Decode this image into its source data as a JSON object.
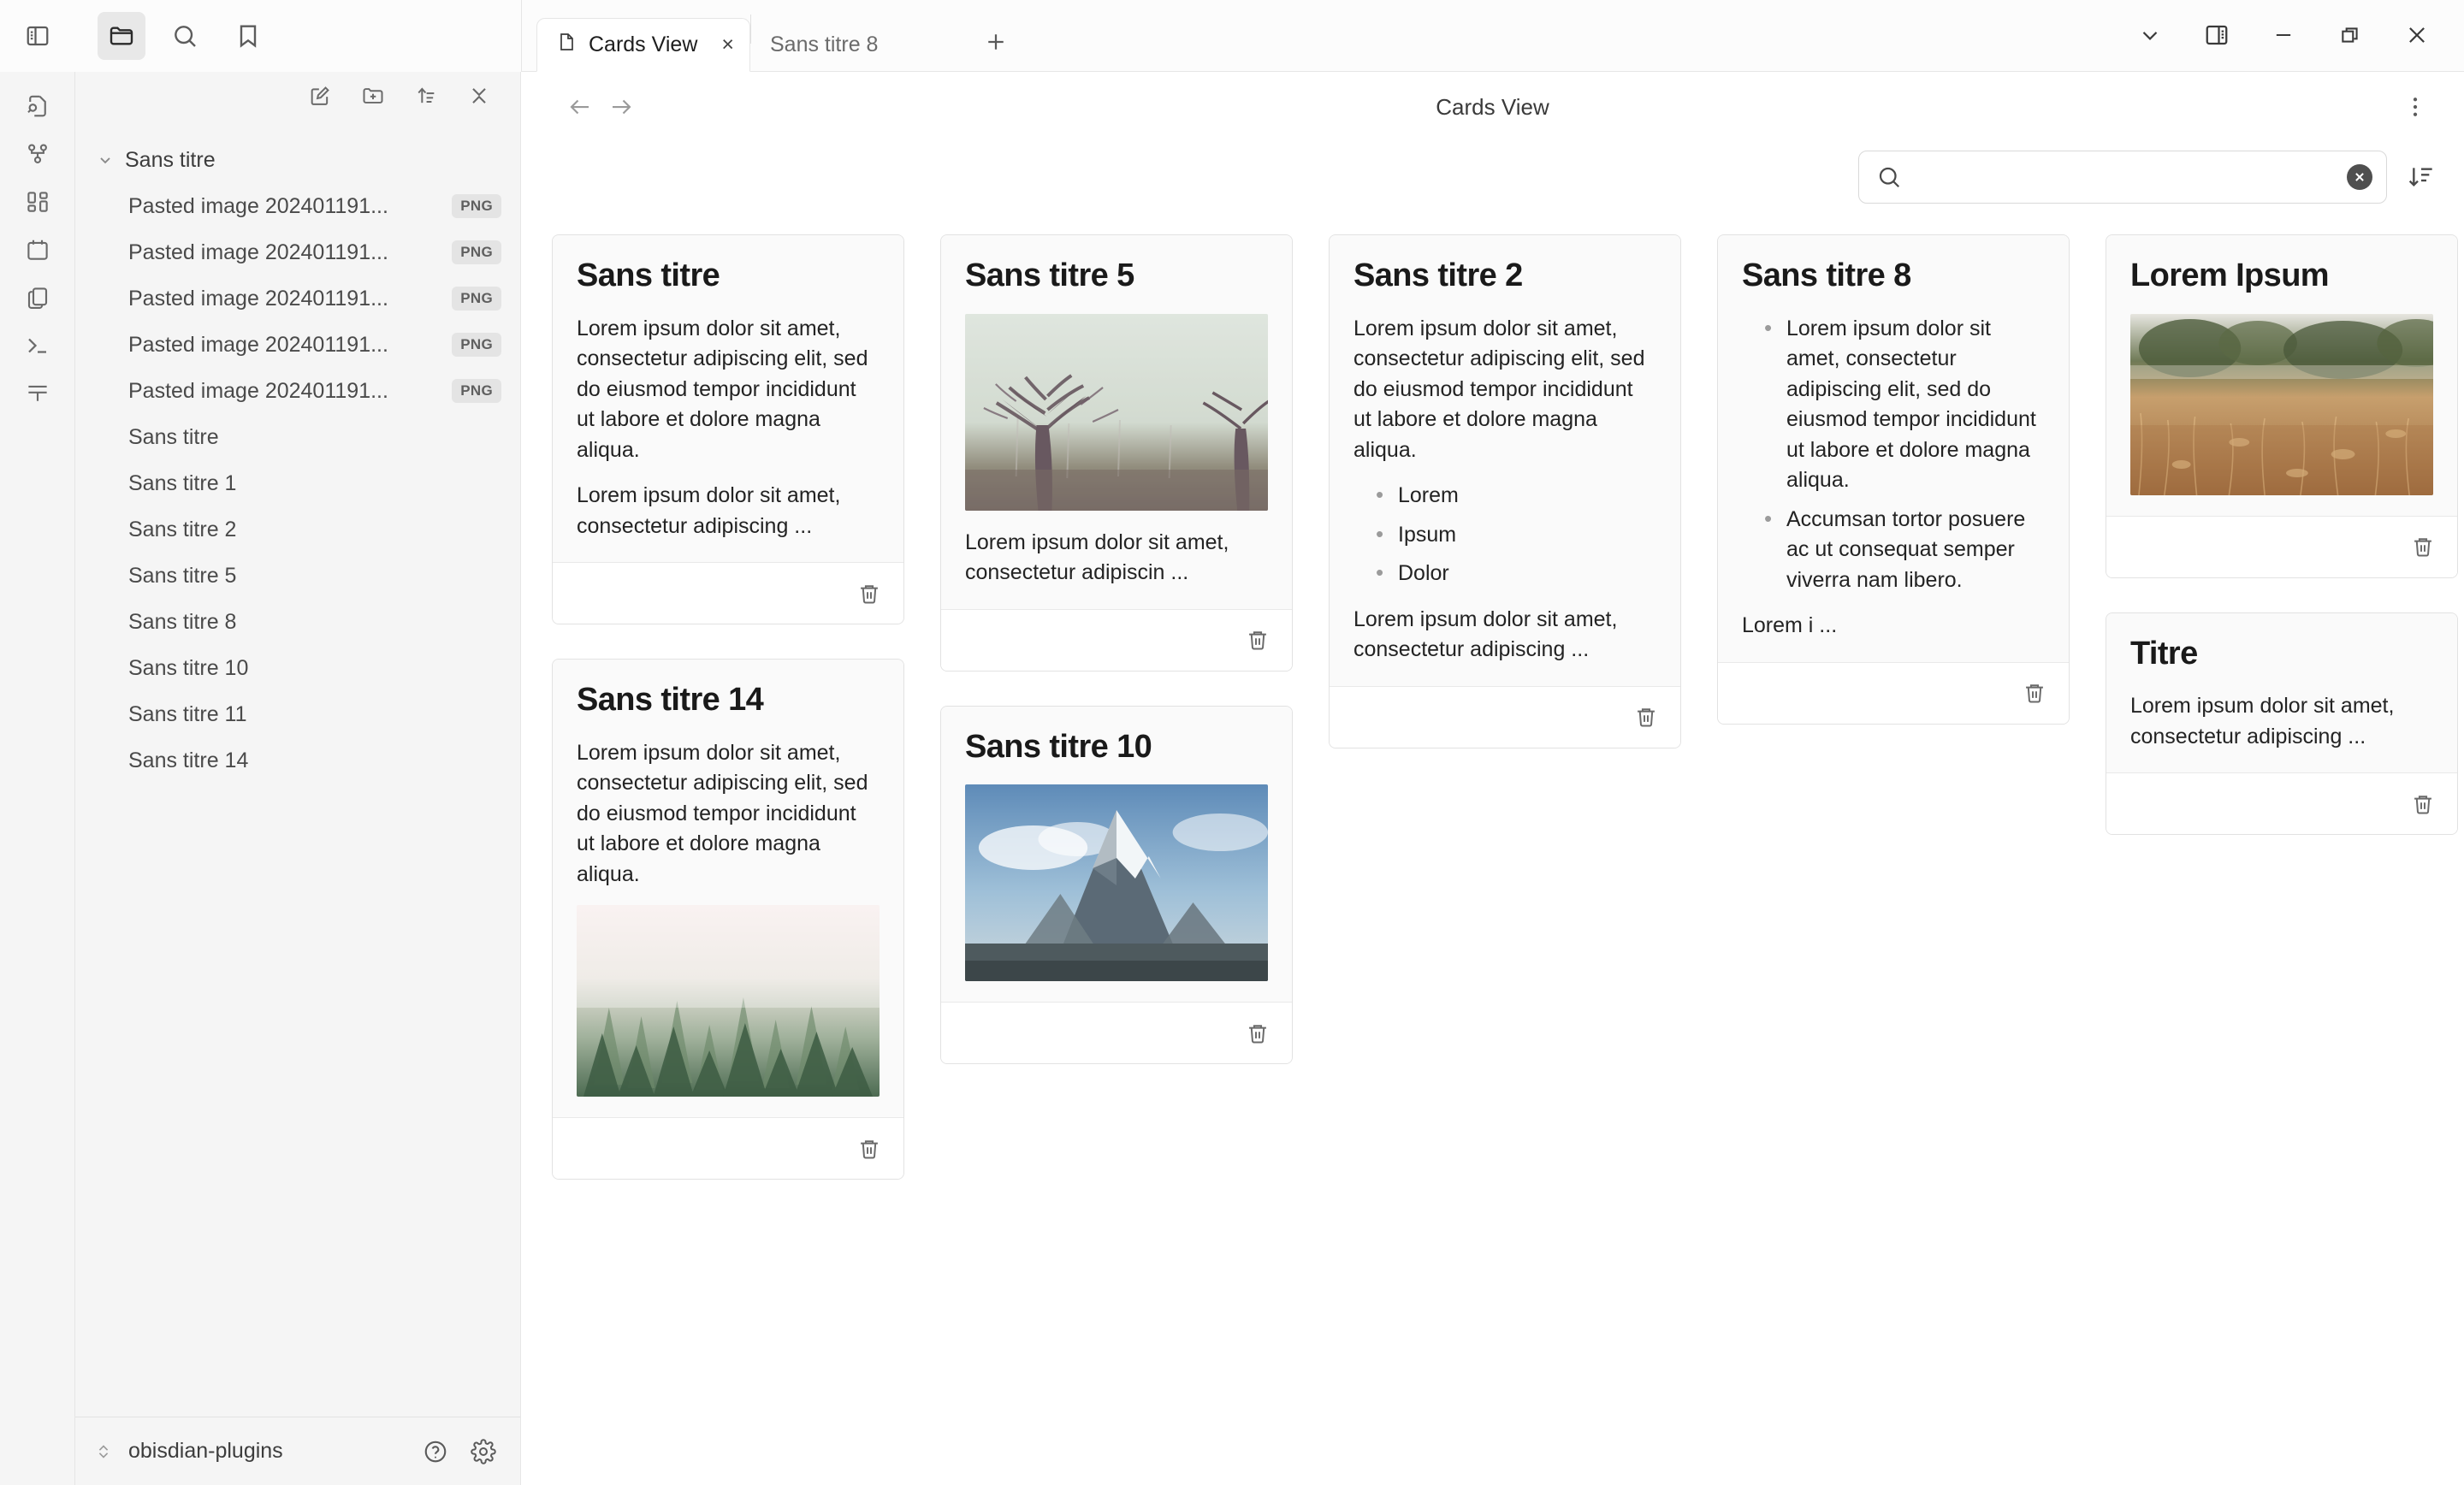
{
  "window": {
    "controls": [
      {
        "name": "chevron-down-icon",
        "label": "Menu"
      },
      {
        "name": "toggle-right-sidebar-icon",
        "label": "Toggle right sidebar"
      },
      {
        "name": "minimize-icon",
        "label": "Minimize"
      },
      {
        "name": "restore-icon",
        "label": "Restore"
      },
      {
        "name": "close-icon",
        "label": "Close"
      }
    ]
  },
  "ribbon": {
    "top_icons": [
      {
        "name": "toggle-left-sidebar-icon",
        "active": false
      },
      {
        "name": "folder-icon",
        "active": true
      },
      {
        "name": "search-icon",
        "active": false
      },
      {
        "name": "bookmark-icon",
        "active": false
      }
    ],
    "side_icons": [
      {
        "name": "file-search-icon"
      },
      {
        "name": "graph-view-icon"
      },
      {
        "name": "dashboard-icon"
      },
      {
        "name": "calendar-icon"
      },
      {
        "name": "copy-files-icon"
      },
      {
        "name": "terminal-icon"
      },
      {
        "name": "table-icon"
      }
    ]
  },
  "sidebar": {
    "toolbar": [
      {
        "name": "new-note-icon",
        "label": "New note"
      },
      {
        "name": "new-folder-icon",
        "label": "New folder"
      },
      {
        "name": "sort-order-icon",
        "label": "Change sort order"
      },
      {
        "name": "collapse-all-icon",
        "label": "Collapse all"
      }
    ],
    "tree": [
      {
        "type": "folder",
        "label": "Sans titre",
        "expanded": true
      },
      {
        "type": "file",
        "label": "Pasted image 202401191...",
        "badge": "PNG"
      },
      {
        "type": "file",
        "label": "Pasted image 202401191...",
        "badge": "PNG"
      },
      {
        "type": "file",
        "label": "Pasted image 202401191...",
        "badge": "PNG"
      },
      {
        "type": "file",
        "label": "Pasted image 202401191...",
        "badge": "PNG"
      },
      {
        "type": "file",
        "label": "Pasted image 202401191...",
        "badge": "PNG"
      },
      {
        "type": "file",
        "label": "Sans titre",
        "badge": ""
      },
      {
        "type": "file",
        "label": "Sans titre 1",
        "badge": ""
      },
      {
        "type": "file",
        "label": "Sans titre 2",
        "badge": ""
      },
      {
        "type": "file",
        "label": "Sans titre 5",
        "badge": ""
      },
      {
        "type": "file",
        "label": "Sans titre 8",
        "badge": ""
      },
      {
        "type": "file",
        "label": "Sans titre 10",
        "badge": ""
      },
      {
        "type": "file",
        "label": "Sans titre 11",
        "badge": ""
      },
      {
        "type": "file",
        "label": "Sans titre 14",
        "badge": ""
      }
    ],
    "status": {
      "vault_name": "obisdian-plugins",
      "vault_switch_icon": "chevron-up-down-icon",
      "help_icon": "help-circle-icon",
      "settings_icon": "gear-icon"
    }
  },
  "tabs": {
    "items": [
      {
        "label": "Cards View",
        "icon": "file-icon",
        "active": true,
        "close_label": "×"
      },
      {
        "label": "Sans titre 8",
        "icon": "",
        "active": false,
        "close_label": ""
      }
    ],
    "add_label": "+"
  },
  "main": {
    "title": "Cards View",
    "back_icon": "arrow-left-icon",
    "forward_icon": "arrow-right-icon",
    "more_icon": "more-vertical-icon",
    "search": {
      "value": "",
      "placeholder": "",
      "icon": "search-icon",
      "clear_icon": "clear-circle-icon"
    },
    "sort_icon": "sort-descending-icon",
    "delete_icon": "trash-icon"
  },
  "cards": {
    "columns": [
      [
        {
          "id": "card-sans-titre",
          "title": "Sans titre",
          "blocks": [
            {
              "type": "p",
              "text": "Lorem ipsum dolor sit amet, consectetur adipiscing elit, sed do eiusmod tempor incididunt ut labore et dolore magna aliqua."
            },
            {
              "type": "p",
              "text": "Lorem ipsum dolor sit amet, consectetur adipiscing ..."
            }
          ]
        },
        {
          "id": "card-sans-titre-14",
          "title": "Sans titre 14",
          "blocks": [
            {
              "type": "p",
              "text": "Lorem ipsum dolor sit amet, consectetur adipiscing elit, sed do eiusmod tempor incididunt ut labore et dolore magna aliqua."
            },
            {
              "type": "img",
              "image": "forest-fog",
              "last": true
            }
          ]
        }
      ],
      [
        {
          "id": "card-sans-titre-5",
          "title": "Sans titre 5",
          "blocks": [
            {
              "type": "img",
              "image": "trees-fog"
            },
            {
              "type": "p",
              "text": "Lorem ipsum dolor sit amet, consectetur adipiscin ..."
            }
          ]
        },
        {
          "id": "card-sans-titre-10",
          "title": "Sans titre 10",
          "blocks": [
            {
              "type": "img",
              "image": "mountain-snow",
              "last": true
            }
          ]
        }
      ],
      [
        {
          "id": "card-sans-titre-2",
          "title": "Sans titre 2",
          "blocks": [
            {
              "type": "p",
              "text": "Lorem ipsum dolor sit amet, consectetur adipiscing elit, sed do eiusmod tempor incididunt ut labore et dolore magna aliqua."
            },
            {
              "type": "ul",
              "items": [
                "Lorem",
                "Ipsum",
                "Dolor"
              ]
            },
            {
              "type": "p",
              "text": "Lorem ipsum dolor sit amet, consectetur adipiscing ..."
            }
          ]
        }
      ],
      [
        {
          "id": "card-sans-titre-8",
          "title": "Sans titre 8",
          "blocks": [
            {
              "type": "ul",
              "items": [
                "Lorem ipsum dolor sit amet, consectetur adipiscing elit, sed do eiusmod tempor incididunt ut labore et dolore magna aliqua.",
                "Accumsan tortor posuere ac ut consequat semper viverra nam libero."
              ]
            },
            {
              "type": "p",
              "text": "Lorem i ..."
            }
          ]
        }
      ],
      [
        {
          "id": "card-lorem-ipsum",
          "title": "Lorem Ipsum",
          "blocks": [
            {
              "type": "img",
              "image": "golden-grass",
              "last": true
            }
          ]
        },
        {
          "id": "card-titre",
          "title": "Titre",
          "blocks": [
            {
              "type": "p",
              "text": "Lorem ipsum dolor sit amet, consectetur adipiscing ..."
            }
          ]
        }
      ]
    ]
  }
}
